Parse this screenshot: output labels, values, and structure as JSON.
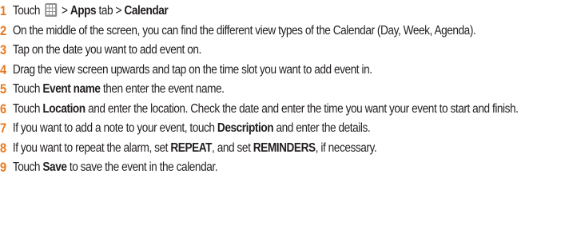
{
  "accent_color": "#e8771c",
  "steps": [
    {
      "number": "1",
      "parts": [
        {
          "text": "Touch "
        },
        {
          "icon": "apps-grid-icon"
        },
        {
          "text": " > "
        },
        {
          "text": "Apps",
          "bold": true
        },
        {
          "text": " tab > "
        },
        {
          "text": "Calendar",
          "bold": true
        }
      ]
    },
    {
      "number": "2",
      "parts": [
        {
          "text": "On the middle of the screen, you can find the different view types of the Calendar (Day, Week, Agenda)."
        }
      ]
    },
    {
      "number": "3",
      "parts": [
        {
          "text": "Tap on the date you want to add event on."
        }
      ]
    },
    {
      "number": "4",
      "parts": [
        {
          "text": "Drag the view screen upwards and tap on the time slot you want to add event in."
        }
      ]
    },
    {
      "number": "5",
      "parts": [
        {
          "text": "Touch "
        },
        {
          "text": "Event name",
          "bold": true
        },
        {
          "text": " then enter the event name."
        }
      ]
    },
    {
      "number": "6",
      "parts": [
        {
          "text": "Touch "
        },
        {
          "text": "Location",
          "bold": true
        },
        {
          "text": " and enter the location. Check the date and enter the time you want your event to start and finish."
        }
      ]
    },
    {
      "number": "7",
      "parts": [
        {
          "text": "If you want to add a note to your event, touch "
        },
        {
          "text": "Description",
          "bold": true
        },
        {
          "text": " and enter the details."
        }
      ]
    },
    {
      "number": "8",
      "parts": [
        {
          "text": "If you want to repeat the alarm, set "
        },
        {
          "text": "REPEAT",
          "bold": true
        },
        {
          "text": ", and set "
        },
        {
          "text": "REMINDERS",
          "bold": true
        },
        {
          "text": ", if necessary."
        }
      ]
    },
    {
      "number": "9",
      "parts": [
        {
          "text": "Touch "
        },
        {
          "text": "Save",
          "bold": true
        },
        {
          "text": " to save the event in the calendar."
        }
      ]
    }
  ]
}
